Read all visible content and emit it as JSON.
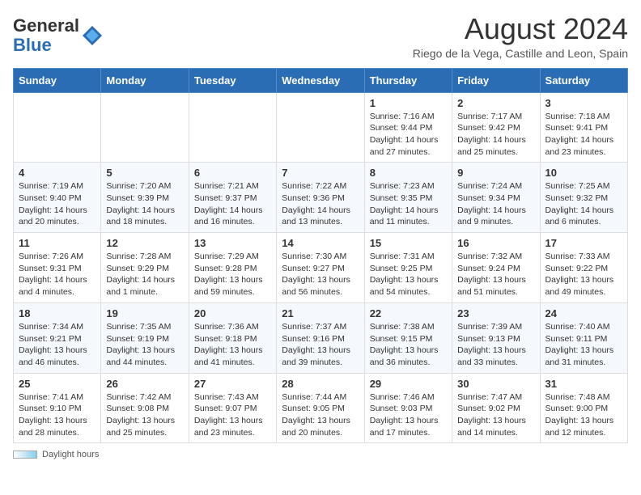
{
  "header": {
    "logo_line1": "General",
    "logo_line2": "Blue",
    "month_title": "August 2024",
    "subtitle": "Riego de la Vega, Castille and Leon, Spain"
  },
  "weekdays": [
    "Sunday",
    "Monday",
    "Tuesday",
    "Wednesday",
    "Thursday",
    "Friday",
    "Saturday"
  ],
  "weeks": [
    [
      {
        "day": "",
        "info": ""
      },
      {
        "day": "",
        "info": ""
      },
      {
        "day": "",
        "info": ""
      },
      {
        "day": "",
        "info": ""
      },
      {
        "day": "1",
        "info": "Sunrise: 7:16 AM\nSunset: 9:44 PM\nDaylight: 14 hours\nand 27 minutes."
      },
      {
        "day": "2",
        "info": "Sunrise: 7:17 AM\nSunset: 9:42 PM\nDaylight: 14 hours\nand 25 minutes."
      },
      {
        "day": "3",
        "info": "Sunrise: 7:18 AM\nSunset: 9:41 PM\nDaylight: 14 hours\nand 23 minutes."
      }
    ],
    [
      {
        "day": "4",
        "info": "Sunrise: 7:19 AM\nSunset: 9:40 PM\nDaylight: 14 hours\nand 20 minutes."
      },
      {
        "day": "5",
        "info": "Sunrise: 7:20 AM\nSunset: 9:39 PM\nDaylight: 14 hours\nand 18 minutes."
      },
      {
        "day": "6",
        "info": "Sunrise: 7:21 AM\nSunset: 9:37 PM\nDaylight: 14 hours\nand 16 minutes."
      },
      {
        "day": "7",
        "info": "Sunrise: 7:22 AM\nSunset: 9:36 PM\nDaylight: 14 hours\nand 13 minutes."
      },
      {
        "day": "8",
        "info": "Sunrise: 7:23 AM\nSunset: 9:35 PM\nDaylight: 14 hours\nand 11 minutes."
      },
      {
        "day": "9",
        "info": "Sunrise: 7:24 AM\nSunset: 9:34 PM\nDaylight: 14 hours\nand 9 minutes."
      },
      {
        "day": "10",
        "info": "Sunrise: 7:25 AM\nSunset: 9:32 PM\nDaylight: 14 hours\nand 6 minutes."
      }
    ],
    [
      {
        "day": "11",
        "info": "Sunrise: 7:26 AM\nSunset: 9:31 PM\nDaylight: 14 hours\nand 4 minutes."
      },
      {
        "day": "12",
        "info": "Sunrise: 7:28 AM\nSunset: 9:29 PM\nDaylight: 14 hours\nand 1 minute."
      },
      {
        "day": "13",
        "info": "Sunrise: 7:29 AM\nSunset: 9:28 PM\nDaylight: 13 hours\nand 59 minutes."
      },
      {
        "day": "14",
        "info": "Sunrise: 7:30 AM\nSunset: 9:27 PM\nDaylight: 13 hours\nand 56 minutes."
      },
      {
        "day": "15",
        "info": "Sunrise: 7:31 AM\nSunset: 9:25 PM\nDaylight: 13 hours\nand 54 minutes."
      },
      {
        "day": "16",
        "info": "Sunrise: 7:32 AM\nSunset: 9:24 PM\nDaylight: 13 hours\nand 51 minutes."
      },
      {
        "day": "17",
        "info": "Sunrise: 7:33 AM\nSunset: 9:22 PM\nDaylight: 13 hours\nand 49 minutes."
      }
    ],
    [
      {
        "day": "18",
        "info": "Sunrise: 7:34 AM\nSunset: 9:21 PM\nDaylight: 13 hours\nand 46 minutes."
      },
      {
        "day": "19",
        "info": "Sunrise: 7:35 AM\nSunset: 9:19 PM\nDaylight: 13 hours\nand 44 minutes."
      },
      {
        "day": "20",
        "info": "Sunrise: 7:36 AM\nSunset: 9:18 PM\nDaylight: 13 hours\nand 41 minutes."
      },
      {
        "day": "21",
        "info": "Sunrise: 7:37 AM\nSunset: 9:16 PM\nDaylight: 13 hours\nand 39 minutes."
      },
      {
        "day": "22",
        "info": "Sunrise: 7:38 AM\nSunset: 9:15 PM\nDaylight: 13 hours\nand 36 minutes."
      },
      {
        "day": "23",
        "info": "Sunrise: 7:39 AM\nSunset: 9:13 PM\nDaylight: 13 hours\nand 33 minutes."
      },
      {
        "day": "24",
        "info": "Sunrise: 7:40 AM\nSunset: 9:11 PM\nDaylight: 13 hours\nand 31 minutes."
      }
    ],
    [
      {
        "day": "25",
        "info": "Sunrise: 7:41 AM\nSunset: 9:10 PM\nDaylight: 13 hours\nand 28 minutes."
      },
      {
        "day": "26",
        "info": "Sunrise: 7:42 AM\nSunset: 9:08 PM\nDaylight: 13 hours\nand 25 minutes."
      },
      {
        "day": "27",
        "info": "Sunrise: 7:43 AM\nSunset: 9:07 PM\nDaylight: 13 hours\nand 23 minutes."
      },
      {
        "day": "28",
        "info": "Sunrise: 7:44 AM\nSunset: 9:05 PM\nDaylight: 13 hours\nand 20 minutes."
      },
      {
        "day": "29",
        "info": "Sunrise: 7:46 AM\nSunset: 9:03 PM\nDaylight: 13 hours\nand 17 minutes."
      },
      {
        "day": "30",
        "info": "Sunrise: 7:47 AM\nSunset: 9:02 PM\nDaylight: 13 hours\nand 14 minutes."
      },
      {
        "day": "31",
        "info": "Sunrise: 7:48 AM\nSunset: 9:00 PM\nDaylight: 13 hours\nand 12 minutes."
      }
    ]
  ],
  "footer": {
    "daylight_label": "Daylight hours"
  }
}
